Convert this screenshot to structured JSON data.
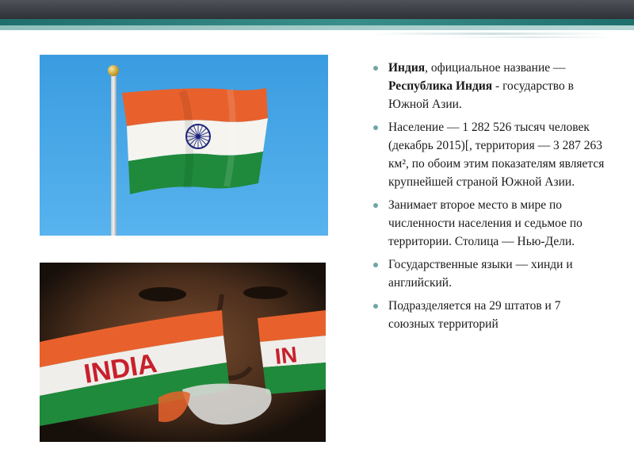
{
  "slide": {
    "bullets": [
      {
        "term": "Индия",
        "text_a": ", официальное название — ",
        "term2": "Республика Индия",
        "text_b": " - государство в Южной Азии."
      },
      {
        "text": "Население — 1 282 526 тысяч человек (декабрь 2015)[, территория — 3 287 263 км², по обоим этим показателям является крупнейшей страной Южной Азии."
      },
      {
        "text": "Занимает второе место в мире по численности населения и седьмое по территории. Столица — Нью-Дели."
      },
      {
        "text": "Государственные языки — хинди и английский."
      },
      {
        "text": "Подразделяется на 29 штатов и 7 союзных территорий"
      }
    ],
    "face_paint_text": "INDIA",
    "face_paint_text_right": "IN"
  },
  "colors": {
    "saffron": "#e8612c",
    "white": "#f7f7f4",
    "green": "#1f8a3b",
    "chakra_blue": "#1a237e",
    "bullet": "#6fa6a6",
    "accent_teal": "#1f6f6c"
  }
}
